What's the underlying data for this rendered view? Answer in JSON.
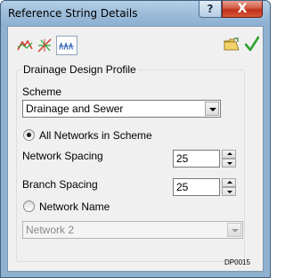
{
  "window": {
    "title": "Reference String Details",
    "help_label": "?",
    "close_label": "X"
  },
  "toolbar": {
    "icons": [
      "profile-icon",
      "network-icon",
      "branch-icon",
      "open-folder-icon",
      "ok-check-icon"
    ],
    "accent_red": "#d4382a",
    "accent_green": "#2fa32f"
  },
  "group": {
    "title": "Drainage Design Profile",
    "scheme_label": "Scheme",
    "scheme_value": "Drainage and Sewer",
    "all_networks_label": "All Networks in Scheme",
    "all_networks_selected": true,
    "network_spacing_label": "Network Spacing",
    "network_spacing_value": "25",
    "branch_spacing_label": "Branch Spacing",
    "branch_spacing_value": "25",
    "network_name_label": "Network Name",
    "network_name_selected": false,
    "network_name_value": "Network 2"
  },
  "footer": {
    "code": "DP0015"
  }
}
